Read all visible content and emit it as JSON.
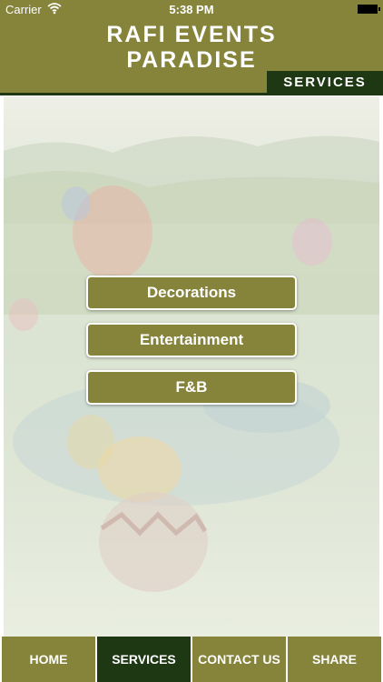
{
  "status_bar": {
    "carrier": "Carrier",
    "time": "5:38 PM"
  },
  "header": {
    "title": "RAFI EVENTS\nPARADISE",
    "section": "SERVICES"
  },
  "menu": [
    {
      "label": "Decorations"
    },
    {
      "label": "Entertainment"
    },
    {
      "label": "F&B"
    }
  ],
  "tabs": [
    {
      "label": "HOME",
      "active": false
    },
    {
      "label": "SERVICES",
      "active": true
    },
    {
      "label": "CONTACT US",
      "active": false
    },
    {
      "label": "SHARE",
      "active": false
    }
  ],
  "colors": {
    "olive": "#86833b",
    "dark_green": "#1f3814",
    "text": "#ffffff"
  },
  "icons": [
    "wifi-icon",
    "battery-icon"
  ]
}
